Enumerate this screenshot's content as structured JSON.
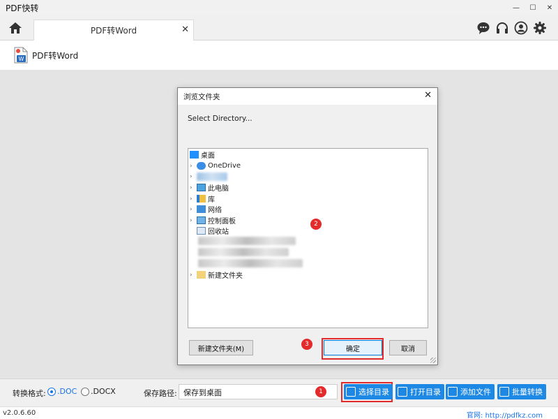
{
  "app": {
    "title": "PDF快转"
  },
  "window_controls": {
    "minimize": "—",
    "maximize": "☐",
    "close": "✕"
  },
  "tab": {
    "label": "PDF转Word",
    "close": "✕"
  },
  "toolbar_icons": [
    "chat-icon",
    "headset-icon",
    "user-icon",
    "gear-icon"
  ],
  "feature": {
    "label": "PDF转Word"
  },
  "dialog": {
    "title": "浏览文件夹",
    "close": "✕",
    "prompt": "Select Directory...",
    "tree": {
      "root": "桌面",
      "items": [
        "OneDrive",
        "此电脑",
        "库",
        "网络",
        "控制面板",
        "回收站",
        "新建文件夹"
      ]
    },
    "new_folder_button": "新建文件夹(M)",
    "ok_button": "确定",
    "cancel_button": "取消"
  },
  "annotations": {
    "badge_1": "1",
    "badge_2": "2",
    "badge_3": "3",
    "color": "#e32b2b"
  },
  "bottom": {
    "format_label": "转换格式:",
    "format_options": [
      ".DOC",
      ".DOCX"
    ],
    "selected_format": ".DOC",
    "save_path_label": "保存路径:",
    "save_path_value": "保存到桌面",
    "buttons": {
      "choose_dir": "选择目录",
      "open_dir": "打开目录",
      "add_file": "添加文件",
      "batch_convert": "批量转换"
    },
    "accent": "#1e88e5"
  },
  "status": {
    "version": "v2.0.6.60",
    "site": "官网: http://pdfkz.com"
  }
}
